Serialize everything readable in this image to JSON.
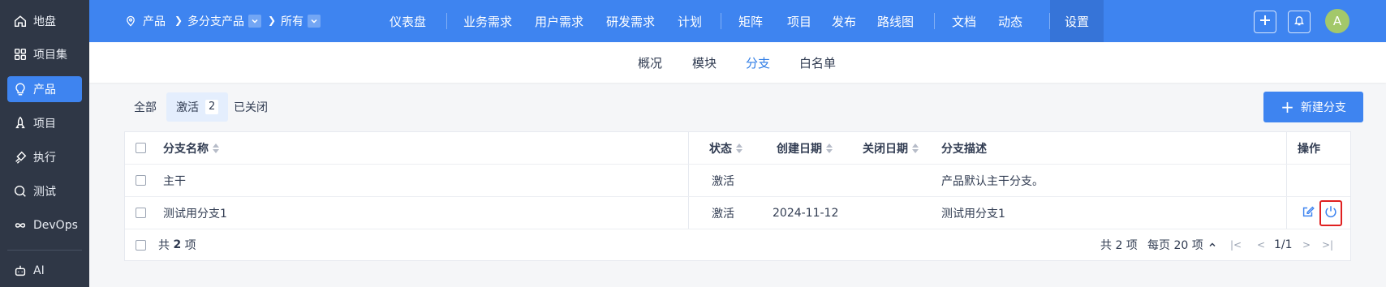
{
  "sidebar": {
    "items": [
      {
        "label": "地盘",
        "icon": "home-icon"
      },
      {
        "label": "项目集",
        "icon": "grid-icon"
      },
      {
        "label": "产品",
        "icon": "bulb-icon",
        "active": true
      },
      {
        "label": "项目",
        "icon": "rocket-icon"
      },
      {
        "label": "执行",
        "icon": "run-icon"
      },
      {
        "label": "测试",
        "icon": "test-search-icon"
      },
      {
        "label": "DevOps",
        "icon": "infinity-icon"
      },
      {
        "label": "AI",
        "icon": "robot-icon"
      }
    ]
  },
  "breadcrumb": {
    "product": "产品",
    "current": "多分支产品",
    "scope": "所有"
  },
  "nav": {
    "items": [
      "仪表盘",
      "业务需求",
      "用户需求",
      "研发需求",
      "计划",
      "矩阵",
      "项目",
      "发布",
      "路线图",
      "文档",
      "动态",
      "设置"
    ],
    "active": "设置"
  },
  "subnav": {
    "items": [
      "概况",
      "模块",
      "分支",
      "白名单"
    ],
    "active": "分支"
  },
  "filters": {
    "all": "全部",
    "active": "激活",
    "active_count": "2",
    "closed": "已关闭"
  },
  "new_branch_label": "新建分支",
  "table": {
    "headers": {
      "name": "分支名称",
      "status": "状态",
      "created": "创建日期",
      "closed": "关闭日期",
      "desc": "分支描述",
      "actions": "操作"
    },
    "rows": [
      {
        "name": "主干",
        "status": "激活",
        "created": "",
        "closed": "",
        "desc": "产品默认主干分支。"
      },
      {
        "name": "测试用分支1",
        "status": "激活",
        "created": "2024-11-12",
        "closed": "",
        "desc": "测试用分支1"
      }
    ],
    "footer": {
      "total_prefix": "共",
      "total_count": "2",
      "total_suffix": "项",
      "pager_total": "共 2 项",
      "per_page": "每页 20 项",
      "page": "1/1"
    }
  },
  "user": {
    "avatar_letter": "A"
  },
  "colors": {
    "accent": "#3e84f0",
    "sidebar": "#2f3746",
    "highlight": "#e02020"
  }
}
